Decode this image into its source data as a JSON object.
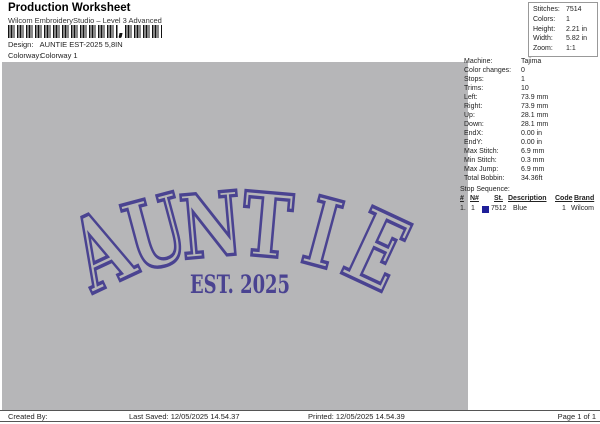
{
  "header": {
    "title": "Production Worksheet",
    "subtitle": "Wilcom EmbroideryStudio – Level 3 Advanced",
    "design_label": "Design:",
    "design_value": "AUNTIE EST-2025 5,8IN",
    "colorway_label": "Colorway:",
    "colorway_value": "Colorway 1"
  },
  "stats_box": {
    "rows": [
      {
        "label": "Stitches:",
        "value": "7514"
      },
      {
        "label": "Colors:",
        "value": "1"
      },
      {
        "label": "Height:",
        "value": "2.21 in"
      },
      {
        "label": "Width:",
        "value": "5.82 in"
      },
      {
        "label": "Zoom:",
        "value": "1:1"
      }
    ]
  },
  "machine_panel": {
    "rows": [
      {
        "label": "Machine:",
        "value": "Tajima"
      },
      {
        "label": "Color changes:",
        "value": "0"
      },
      {
        "label": "Stops:",
        "value": "1"
      },
      {
        "label": "Trims:",
        "value": "10"
      },
      {
        "label": "Left:",
        "value": "73.9 mm"
      },
      {
        "label": "Right:",
        "value": "73.9 mm"
      },
      {
        "label": "Up:",
        "value": "28.1 mm"
      },
      {
        "label": "Down:",
        "value": "28.1 mm"
      },
      {
        "label": "EndX:",
        "value": "0.00 in"
      },
      {
        "label": "EndY:",
        "value": "0.00 in"
      },
      {
        "label": "Max Stitch:",
        "value": "6.9 mm"
      },
      {
        "label": "Min Stitch:",
        "value": "0.3 mm"
      },
      {
        "label": "Max Jump:",
        "value": "6.9 mm"
      },
      {
        "label": "Total Bobbin:",
        "value": "34.36ft"
      }
    ]
  },
  "stop_sequence": {
    "title": "Stop Sequence:",
    "columns": {
      "num": "#",
      "n": "N#",
      "st": "St.",
      "description": "Description",
      "code": "Code",
      "brand": "Brand"
    },
    "rows": [
      {
        "num": "1.",
        "n": "1",
        "swatch_color": "#1f1f99",
        "st": "7512",
        "description": "Blue",
        "code": "1",
        "brand": "Wilcom"
      }
    ]
  },
  "design": {
    "arch_text": "AUNTIE",
    "sub_text": "EST. 2025",
    "thread_color": "#4a4391",
    "fabric_color": "#b6b6b8"
  },
  "footer": {
    "created_by": "Created By:",
    "last_saved": "Last Saved: 12/05/2025 14.54.37",
    "printed": "Printed: 12/05/2025 14.54.39",
    "page": "Page 1 of 1"
  }
}
